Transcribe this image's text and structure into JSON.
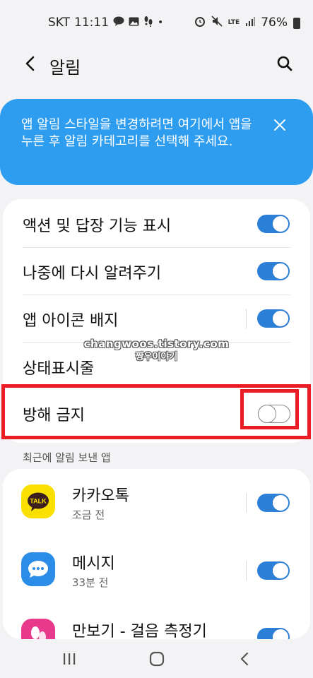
{
  "status_bar": {
    "carrier": "SKT",
    "time": "11:11",
    "battery": "76%",
    "network": "LTE"
  },
  "header": {
    "title": "알림"
  },
  "tip": {
    "text": "앱 알림 스타일을 변경하려면 여기에서 앱을 누른 후 알림 카테고리를 선택해 주세요."
  },
  "settings": [
    {
      "label": "액션 및 답장 기능 표시",
      "on": true
    },
    {
      "label": "나중에 다시 알려주기",
      "on": true
    },
    {
      "label": "앱 아이콘 배지",
      "on": true
    },
    {
      "label": "상태표시줄"
    },
    {
      "label": "방해 금지",
      "on": false
    }
  ],
  "watermark": {
    "line1": "changwoos.tistory.com",
    "line2": "짱우이야기"
  },
  "recent_apps": {
    "section_title": "최근에 알림 보낸 앱",
    "apps": [
      {
        "name": "카카오톡",
        "time": "조금 전",
        "icon": "talk-icon",
        "icon_text": "TALK",
        "on": true
      },
      {
        "name": "메시지",
        "time": "33분 전",
        "icon": "message-icon",
        "on": true
      },
      {
        "name": "만보기 - 걸음 측정기",
        "time": "",
        "icon": "pedometer-icon",
        "on": true
      }
    ]
  },
  "colors": {
    "accent": "#2c7fd7",
    "banner": "#2e9df0",
    "highlight": "#ec1c24",
    "kakao": "#f9e000"
  }
}
